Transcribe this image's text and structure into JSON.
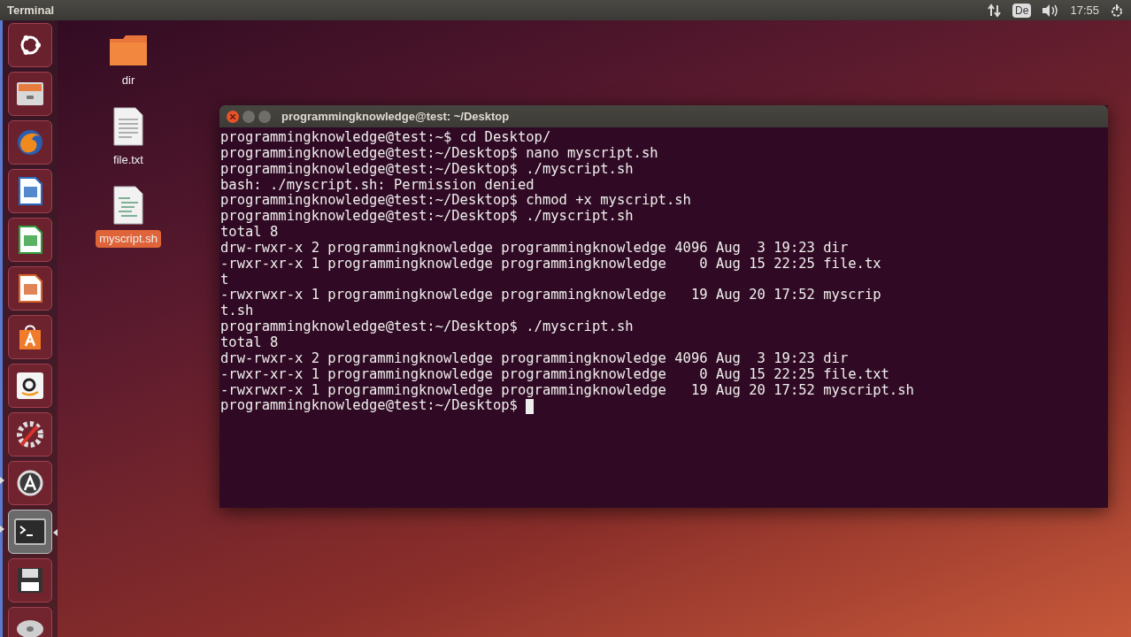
{
  "top_bar": {
    "title": "Terminal",
    "keyboard_layout": "De",
    "clock": "17:55"
  },
  "launcher": [
    {
      "kind": "dash",
      "running": false,
      "focused": false
    },
    {
      "kind": "files",
      "running": false,
      "focused": false
    },
    {
      "kind": "browser",
      "running": false,
      "focused": false
    },
    {
      "kind": "writer",
      "running": false,
      "focused": false
    },
    {
      "kind": "calc",
      "running": false,
      "focused": false
    },
    {
      "kind": "impress",
      "running": false,
      "focused": false
    },
    {
      "kind": "store",
      "running": false,
      "focused": false
    },
    {
      "kind": "amazon",
      "running": false,
      "focused": false
    },
    {
      "kind": "settings",
      "running": false,
      "focused": false
    },
    {
      "kind": "updater",
      "running": true,
      "focused": false
    },
    {
      "kind": "terminal",
      "running": true,
      "focused": true
    },
    {
      "kind": "floppy",
      "running": false,
      "focused": false
    },
    {
      "kind": "dvd",
      "running": false,
      "focused": false
    }
  ],
  "desktop_icons": [
    {
      "kind": "folder",
      "label": "dir",
      "selected": false
    },
    {
      "kind": "text",
      "label": "file.txt",
      "selected": false
    },
    {
      "kind": "script",
      "label": "myscript.sh",
      "selected": true
    }
  ],
  "terminal": {
    "title": "programmingknowledge@test: ~/Desktop",
    "cursor": true,
    "lines": [
      "programmingknowledge@test:~$ cd Desktop/",
      "programmingknowledge@test:~/Desktop$ nano myscript.sh",
      "programmingknowledge@test:~/Desktop$ ./myscript.sh",
      "bash: ./myscript.sh: Permission denied",
      "programmingknowledge@test:~/Desktop$ chmod +x myscript.sh",
      "programmingknowledge@test:~/Desktop$ ./myscript.sh",
      "total 8",
      "drw-rwxr-x 2 programmingknowledge programmingknowledge 4096 Aug  3 19:23 dir",
      "-rwxr-xr-x 1 programmingknowledge programmingknowledge    0 Aug 15 22:25 file.tx",
      "t",
      "-rwxrwxr-x 1 programmingknowledge programmingknowledge   19 Aug 20 17:52 myscrip",
      "t.sh",
      "programmingknowledge@test:~/Desktop$ ./myscript.sh",
      "total 8",
      "drw-rwxr-x 2 programmingknowledge programmingknowledge 4096 Aug  3 19:23 dir",
      "-rwxr-xr-x 1 programmingknowledge programmingknowledge    0 Aug 15 22:25 file.txt",
      "-rwxrwxr-x 1 programmingknowledge programmingknowledge   19 Aug 20 17:52 myscript.sh",
      "programmingknowledge@test:~/Desktop$ "
    ]
  }
}
